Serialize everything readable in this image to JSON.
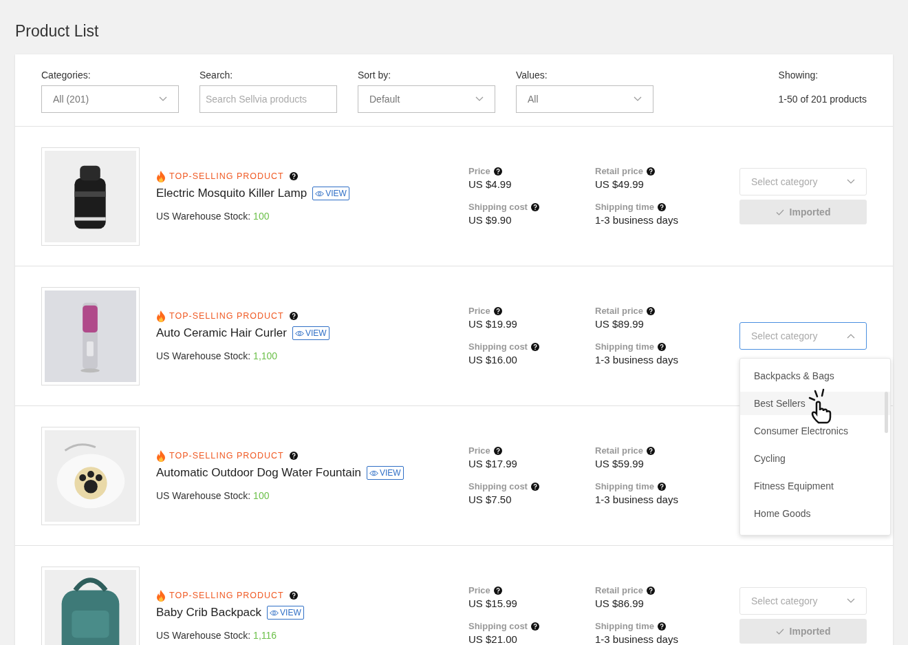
{
  "page_title": "Product List",
  "filters": [
    {
      "kind": "select",
      "label": "Categories:",
      "value": "All (201)"
    },
    {
      "kind": "search",
      "label": "Search:",
      "placeholder": "Search Sellvia products"
    },
    {
      "kind": "select",
      "label": "Sort by:",
      "value": "Default"
    },
    {
      "kind": "select",
      "label": "Values:",
      "value": "All"
    },
    {
      "kind": "info",
      "label": "Showing:",
      "value": "1-50 of 201 products"
    }
  ],
  "products": [
    {
      "badge": "TOP-SELLING PRODUCT",
      "name": "Electric Mosquito Killer Lamp",
      "view": "VIEW",
      "stock_label": "US Warehouse Stock:",
      "stock": "100",
      "price_label": "Price",
      "price": "US $4.99",
      "retail_label": "Retail price",
      "retail": "US $49.99",
      "ship_cost_label": "Shipping cost",
      "ship_cost": "US $9.90",
      "ship_time_label": "Shipping time",
      "ship_time": "1-3 business days",
      "category_select": {
        "placeholder": "Select category",
        "open": false
      },
      "import_button": {
        "label": "Imported",
        "disabled": true
      }
    },
    {
      "badge": "TOP-SELLING PRODUCT",
      "name": "Auto Ceramic Hair Curler",
      "view": "VIEW",
      "stock_label": "US Warehouse Stock:",
      "stock": "1,100",
      "price_label": "Price",
      "price": "US $19.99",
      "retail_label": "Retail price",
      "retail": "US $89.99",
      "ship_cost_label": "Shipping cost",
      "ship_cost": "US $16.00",
      "ship_time_label": "Shipping time",
      "ship_time": "1-3 business days",
      "category_select": {
        "placeholder": "Select category",
        "open": true,
        "options": [
          {
            "label": "Backpacks & Bags",
            "highlighted": false
          },
          {
            "label": "Best Sellers",
            "highlighted": true
          },
          {
            "label": "Consumer Electronics",
            "highlighted": false
          },
          {
            "label": "Cycling",
            "highlighted": false
          },
          {
            "label": "Fitness Equipment",
            "highlighted": false
          },
          {
            "label": "Home Goods",
            "highlighted": false
          }
        ]
      }
    },
    {
      "badge": "TOP-SELLING PRODUCT",
      "name": "Automatic Outdoor Dog Water Fountain",
      "view": "VIEW",
      "stock_label": "US Warehouse Stock:",
      "stock": "100",
      "price_label": "Price",
      "price": "US $17.99",
      "retail_label": "Retail price",
      "retail": "US $59.99",
      "ship_cost_label": "Shipping cost",
      "ship_cost": "US $7.50",
      "ship_time_label": "Shipping time",
      "ship_time": "1-3 business days"
    },
    {
      "badge": "TOP-SELLING PRODUCT",
      "name": "Baby Crib Backpack",
      "view": "VIEW",
      "stock_label": "US Warehouse Stock:",
      "stock": "1,116",
      "price_label": "Price",
      "price": "US $15.99",
      "retail_label": "Retail price",
      "retail": "US $86.99",
      "ship_cost_label": "Shipping cost",
      "ship_cost": "US $21.00",
      "ship_time_label": "Shipping time",
      "ship_time": "1-3 business days",
      "category_select": {
        "placeholder": "Select category",
        "open": false
      },
      "import_button": {
        "label": "Imported",
        "disabled": true
      }
    }
  ]
}
